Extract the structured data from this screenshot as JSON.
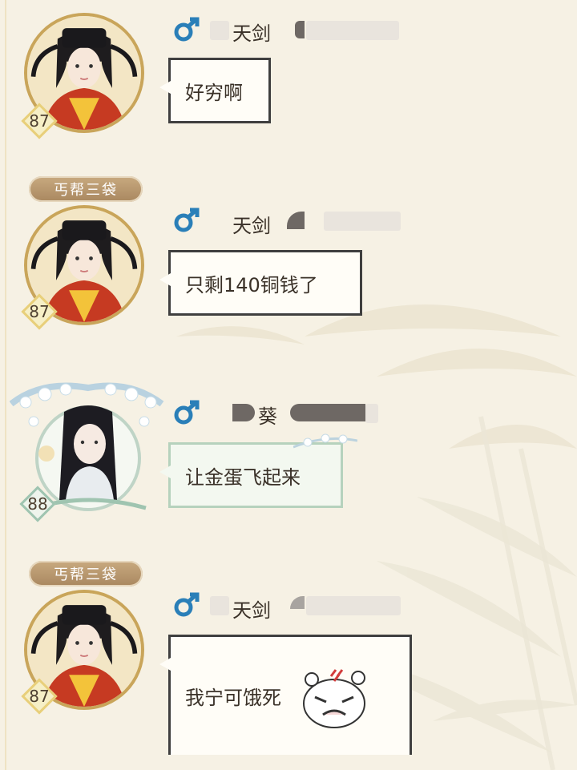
{
  "messages": [
    {
      "title_badge": "",
      "level": "87",
      "name": "天剑",
      "text": "好穷啊"
    },
    {
      "title_badge": "丐帮三袋",
      "level": "87",
      "name": "天剑",
      "text": "只剩140铜钱了"
    },
    {
      "title_badge": "",
      "level": "88",
      "name": "葵",
      "text": "让金蛋飞起来"
    },
    {
      "title_badge": "丐帮三袋",
      "level": "87",
      "name": "天剑",
      "text": "我宁可饿死"
    }
  ],
  "colors": {
    "background": "#f6f1e4",
    "gender_icon": "#2a7fb8",
    "bubble_border": "#3f3f3f",
    "badge": "#b8966b",
    "level_border": "#e8cf7a"
  },
  "icons": {
    "gender": "male-symbol-icon",
    "sticker": "angry-face-sticker-icon"
  }
}
